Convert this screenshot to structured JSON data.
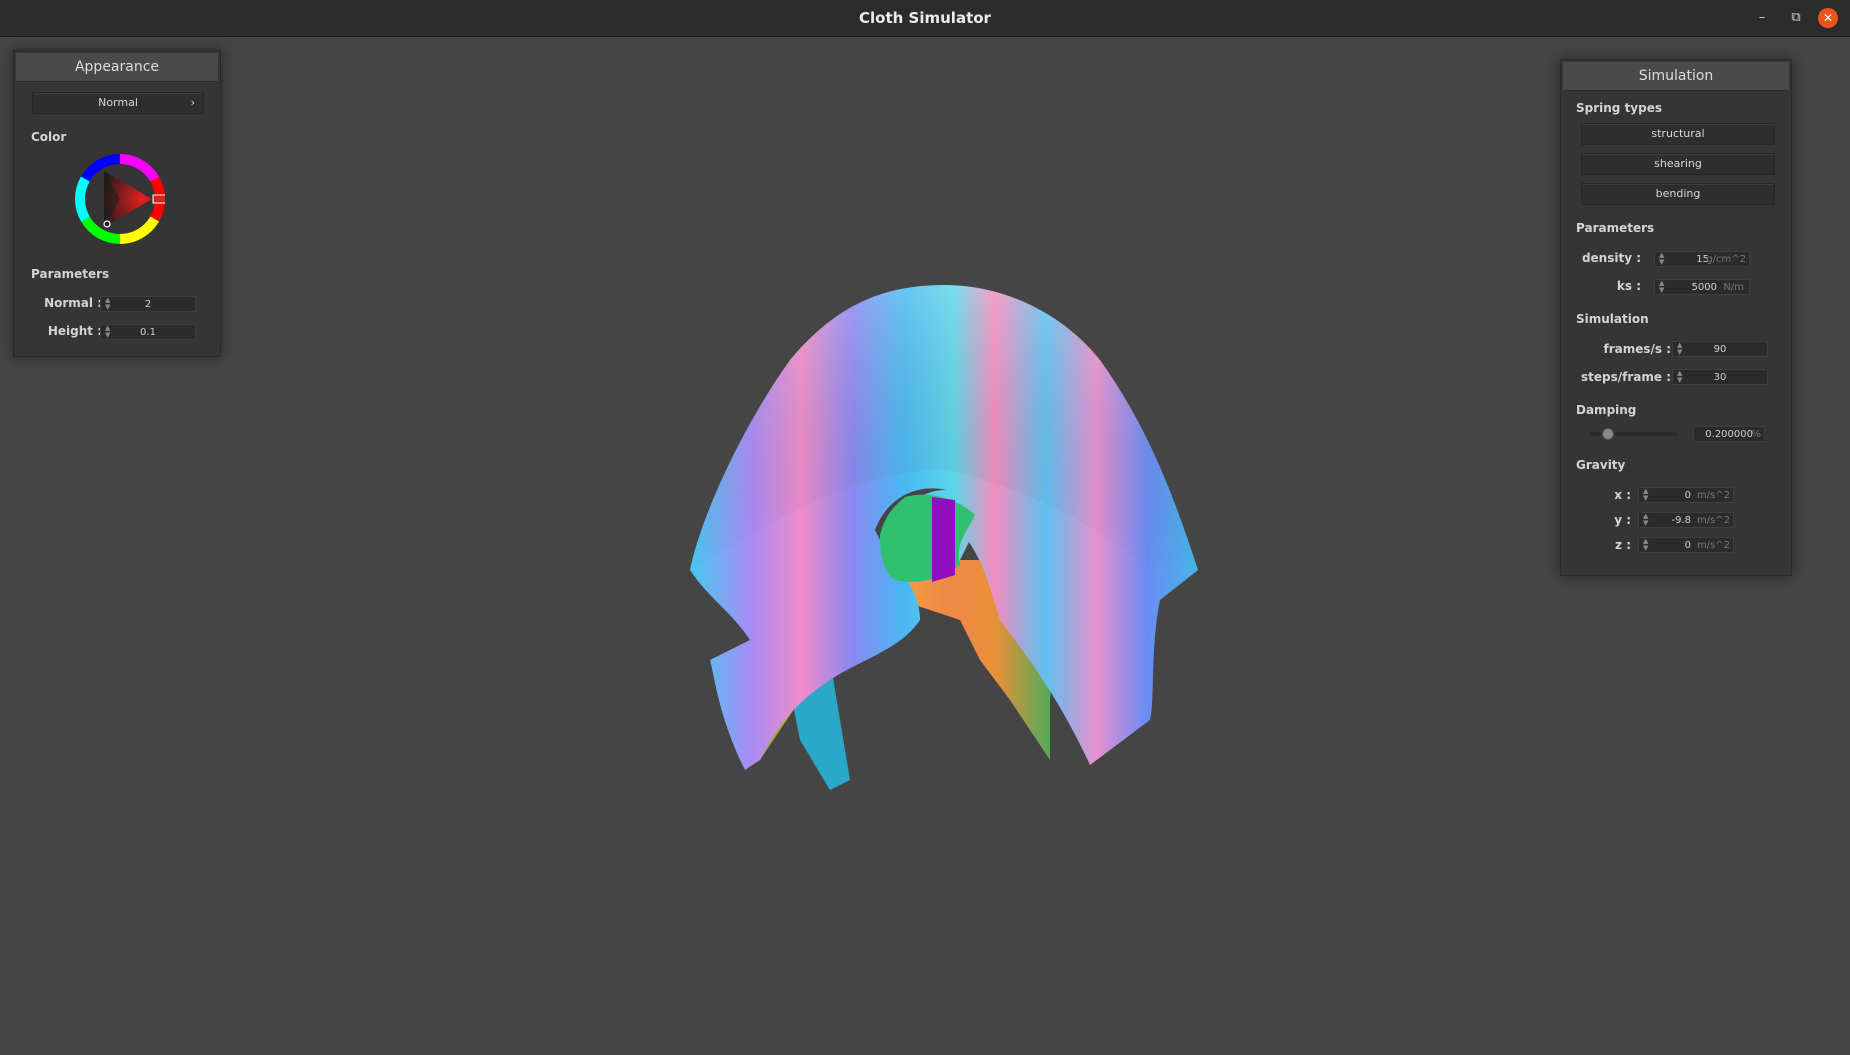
{
  "window": {
    "title": "Cloth Simulator",
    "minimize_glyph": "–",
    "maximize_glyph": "⧉",
    "close_glyph": "✕"
  },
  "appearance": {
    "header": "Appearance",
    "shader_select": "Normal",
    "shader_arrow": "›",
    "color_label": "Color",
    "selected_color": "#e02020",
    "parameters_label": "Parameters",
    "normal_label": "Normal :",
    "normal_value": "2",
    "height_label": "Height :",
    "height_value": "0.1"
  },
  "simulation": {
    "header": "Simulation",
    "spring_types_label": "Spring types",
    "spring_buttons": [
      "structural",
      "shearing",
      "bending"
    ],
    "parameters_label": "Parameters",
    "density_label": "density :",
    "density_value": "15",
    "density_unit": "g/cm^2",
    "ks_label": "ks :",
    "ks_value": "5000",
    "ks_unit": "N/m",
    "simulation_label": "Simulation",
    "fps_label": "frames/s :",
    "fps_value": "90",
    "steps_label": "steps/frame :",
    "steps_value": "30",
    "damping_label": "Damping",
    "damping_value": "0.200000",
    "damping_unit": "%",
    "damping_fraction": 0.2,
    "gravity_label": "Gravity",
    "gx_label": "x :",
    "gx_value": "0",
    "gy_label": "y :",
    "gy_value": "-9.8",
    "gz_label": "z :",
    "gz_value": "0",
    "gravity_unit": "m/s^2"
  },
  "colors": {
    "background": "#454545",
    "panel": "#353535",
    "accent_close": "#e95420"
  }
}
